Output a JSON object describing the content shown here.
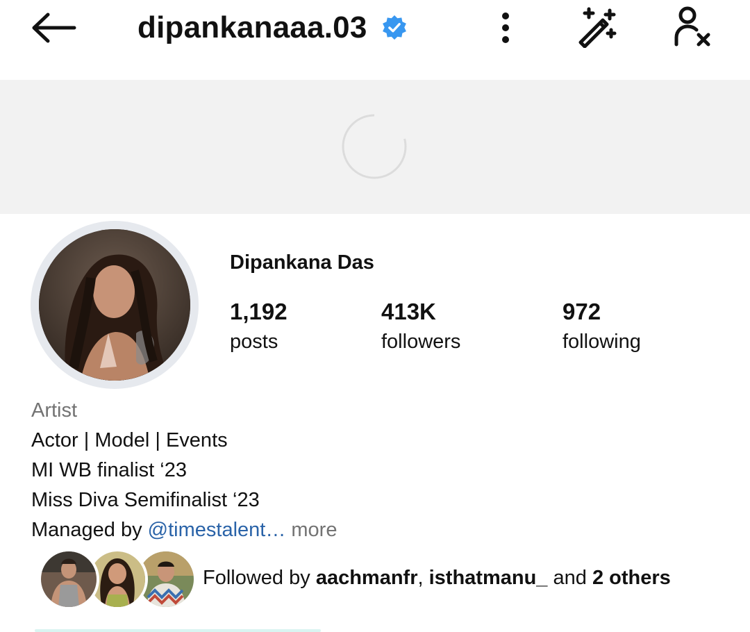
{
  "header": {
    "username": "dipankanaaa.03",
    "verified_color": "#3897f0",
    "icons": [
      "back-arrow-icon",
      "verified-badge-icon",
      "more-vertical-icon",
      "magic-wand-icon",
      "unfollow-user-icon"
    ]
  },
  "cover": {
    "state": "loading"
  },
  "profile": {
    "display_name": "Dipankana Das",
    "stats": {
      "posts_value": "1,192",
      "posts_label": "posts",
      "followers_value": "413K",
      "followers_label": "followers",
      "following_value": "972",
      "following_label": "following"
    }
  },
  "bio": {
    "category": "Artist",
    "line1": "Actor | Model | Events",
    "line2": "MI WB finalist ‘23",
    "line3": "Miss Diva Semifinalist ‘23",
    "managed_prefix": "Managed by ",
    "managed_mention": "@timestalent…",
    "more_label": " more"
  },
  "followed_by": {
    "prefix": "Followed by ",
    "user1": "aachmanfr",
    "separator": ", ",
    "user2": "isthatmanu_",
    "and_text": " and ",
    "others": "2 others"
  },
  "colors": {
    "text": "#111111",
    "muted": "#737373",
    "mention": "#2a63a8",
    "cover_bg": "#f2f2f2"
  }
}
